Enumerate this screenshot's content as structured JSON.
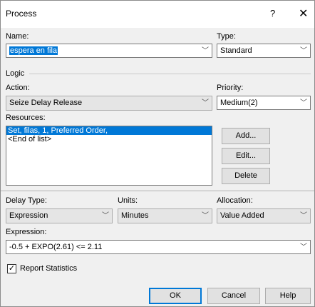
{
  "window": {
    "title": "Process",
    "help_glyph": "?",
    "close_glyph": "✕"
  },
  "name": {
    "label": "Name:",
    "value": "espera en fila"
  },
  "type": {
    "label": "Type:",
    "value": "Standard"
  },
  "logic": {
    "label": "Logic"
  },
  "action": {
    "label": "Action:",
    "value": "Seize Delay Release"
  },
  "priority": {
    "label": "Priority:",
    "value": "Medium(2)"
  },
  "resources": {
    "label": "Resources:",
    "items": [
      "Set, filas, 1, Preferred Order,",
      "<End of list>"
    ],
    "selected_index": 0
  },
  "buttons": {
    "add": "Add...",
    "edit": "Edit...",
    "delete": "Delete",
    "ok": "OK",
    "cancel": "Cancel",
    "help": "Help"
  },
  "delay_type": {
    "label": "Delay Type:",
    "value": "Expression"
  },
  "units": {
    "label": "Units:",
    "value": "Minutes"
  },
  "allocation": {
    "label": "Allocation:",
    "value": "Value Added"
  },
  "expression": {
    "label": "Expression:",
    "value": "-0.5 + EXPO(2.61) <= 2.11"
  },
  "report_statistics": {
    "label": "Report Statistics",
    "checked": true,
    "check_glyph": "✓"
  },
  "icons": {
    "dropdown": "chevron-down-icon",
    "close": "close-icon",
    "help": "help-icon"
  },
  "colors": {
    "selection": "#0078d7",
    "dialog_bg": "#f0f0f0",
    "default_button_border": "#0078d7"
  }
}
